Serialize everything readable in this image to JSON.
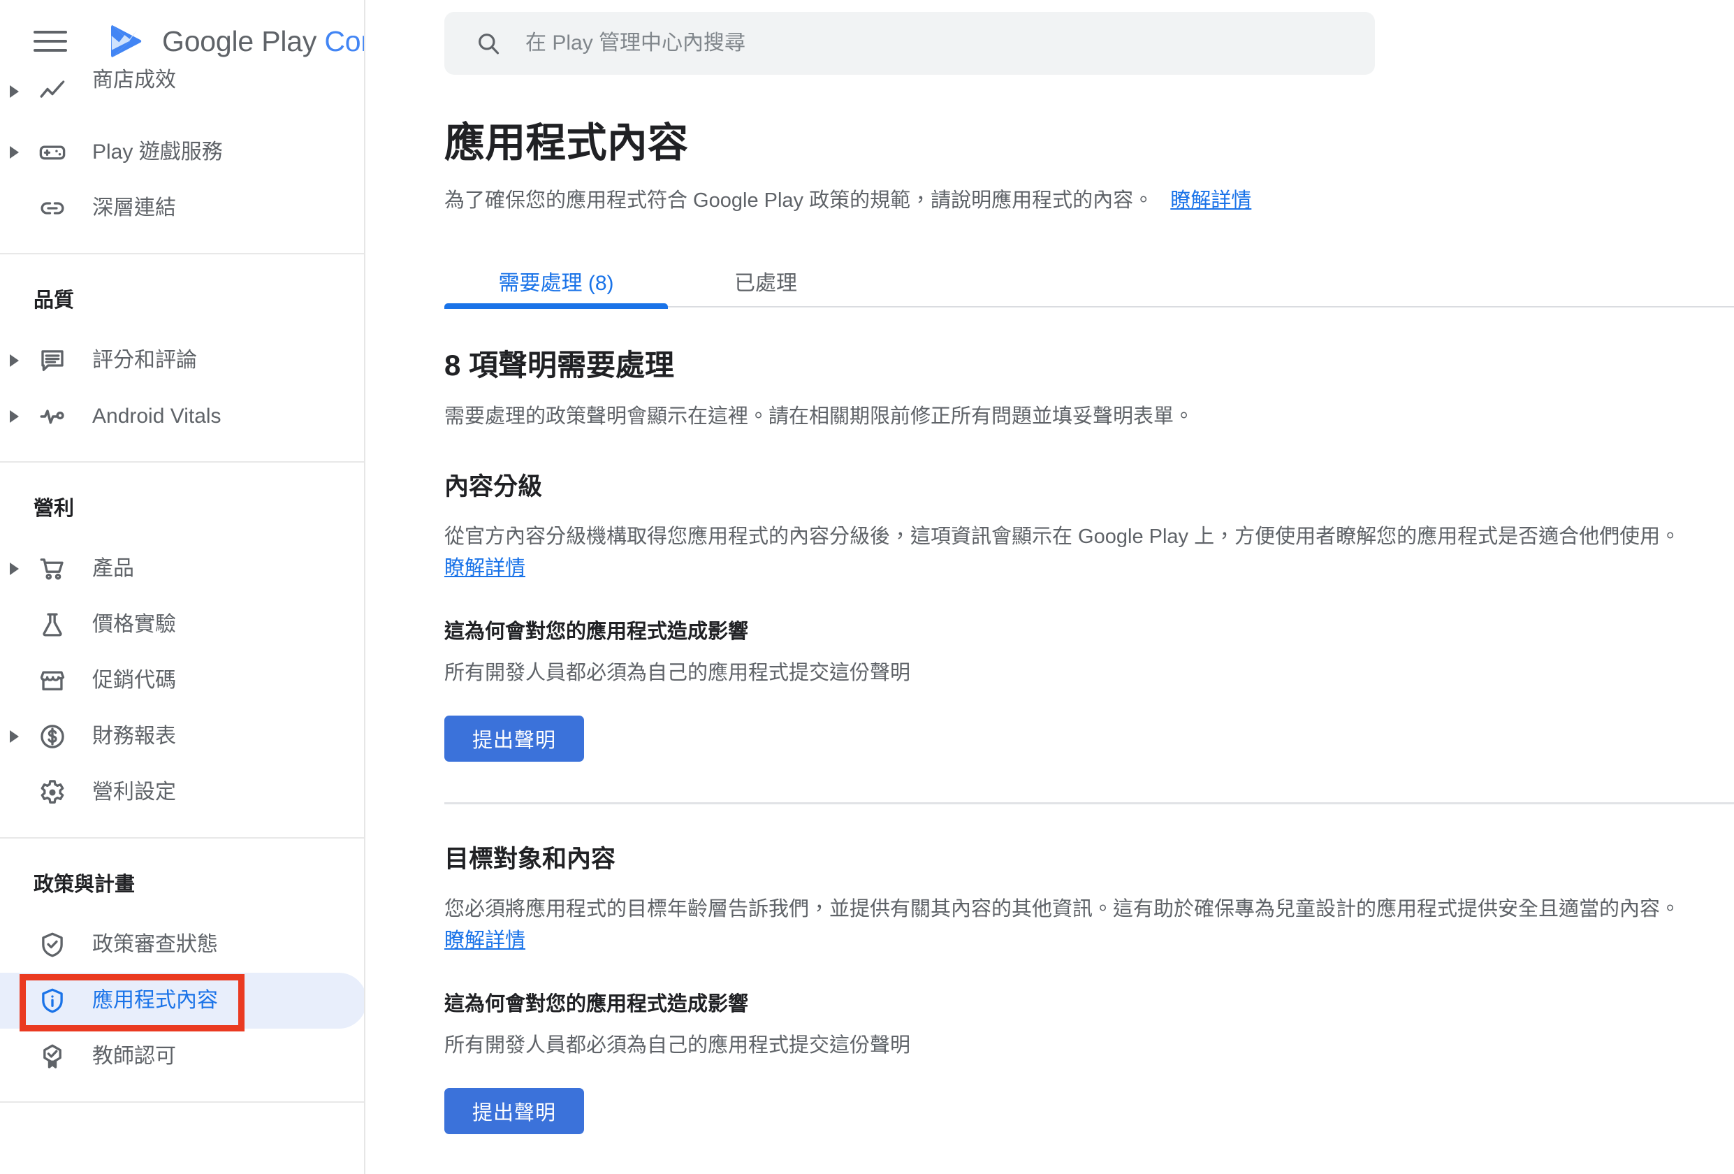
{
  "brand": {
    "menu_icon": "hamburger-menu-icon",
    "logo_icon": "google-play-logo-icon",
    "name_primary": "Google Play",
    "name_secondary": "Console"
  },
  "search": {
    "icon": "search-icon",
    "placeholder": "在 Play 管理中心內搜尋",
    "value": ""
  },
  "sidebar": {
    "groups": [
      {
        "title": null,
        "items": [
          {
            "label": "商店成效",
            "icon": "trending-up-icon",
            "expandable": true,
            "active": false,
            "clipped": true
          },
          {
            "label": "Play 遊戲服務",
            "icon": "gamepad-icon",
            "expandable": true,
            "active": false
          },
          {
            "label": "深層連結",
            "icon": "link-icon",
            "expandable": false,
            "active": false
          }
        ]
      },
      {
        "title": "品質",
        "items": [
          {
            "label": "評分和評論",
            "icon": "review-comment-icon",
            "expandable": true,
            "active": false
          },
          {
            "label": "Android Vitals",
            "icon": "pulse-icon",
            "expandable": true,
            "active": false
          }
        ]
      },
      {
        "title": "營利",
        "items": [
          {
            "label": "產品",
            "icon": "shopping-cart-icon",
            "expandable": true,
            "active": false
          },
          {
            "label": "價格實驗",
            "icon": "flask-icon",
            "expandable": false,
            "active": false
          },
          {
            "label": "促銷代碼",
            "icon": "storefront-icon",
            "expandable": false,
            "active": false
          },
          {
            "label": "財務報表",
            "icon": "dollar-circle-icon",
            "expandable": true,
            "active": false
          },
          {
            "label": "營利設定",
            "icon": "gear-icon",
            "expandable": false,
            "active": false
          }
        ]
      },
      {
        "title": "政策與計畫",
        "items": [
          {
            "label": "政策審查狀態",
            "icon": "shield-check-icon",
            "expandable": false,
            "active": false
          },
          {
            "label": "應用程式內容",
            "icon": "shield-info-icon",
            "expandable": false,
            "active": true
          },
          {
            "label": "教師認可",
            "icon": "badge-check-icon",
            "expandable": false,
            "active": false
          }
        ]
      }
    ],
    "highlight_color": "#ea3a21",
    "active_pill_color": "#e8eefb",
    "active_text_color": "#1a73e8"
  },
  "page": {
    "title": "應用程式內容",
    "subtitle_text": "為了確保您的應用程式符合 Google Play 政策的規範，請說明應用程式的內容。",
    "subtitle_link": "瞭解詳情"
  },
  "tabs": [
    {
      "label": "需要處理 (8)",
      "active": true
    },
    {
      "label": "已處理",
      "active": false
    }
  ],
  "main": {
    "heading": "8 項聲明需要處理",
    "subheading": "需要處理的政策聲明會顯示在這裡。請在相關期限前修正所有問題並填妥聲明表單。",
    "sections": [
      {
        "title": "內容分級",
        "body_text": "從官方內容分級機構取得您應用程式的內容分級後，這項資訊會顯示在 Google Play 上，方便使用者瞭解您的應用程式是否適合他們使用。",
        "body_link": "瞭解詳情",
        "impact_heading": "這為何會對您的應用程式造成影響",
        "impact_text": "所有開發人員都必須為自己的應用程式提交這份聲明",
        "button_label": "提出聲明"
      },
      {
        "title": "目標對象和內容",
        "body_text": "您必須將應用程式的目標年齡層告訴我們，並提供有關其內容的其他資訊。這有助於確保專為兒童設計的應用程式提供安全且適當的內容。",
        "body_link": "瞭解詳情",
        "impact_heading": "這為何會對您的應用程式造成影響",
        "impact_text": "所有開發人員都必須為自己的應用程式提交這份聲明",
        "button_label": "提出聲明"
      }
    ]
  }
}
